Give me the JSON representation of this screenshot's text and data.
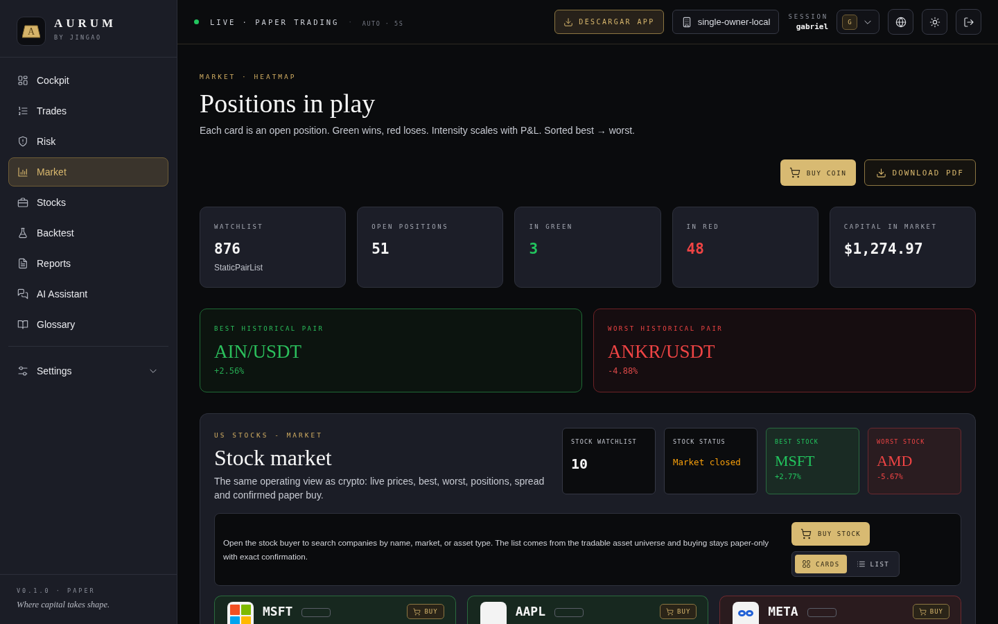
{
  "sidebar": {
    "brand": {
      "mark": "A",
      "name": "AURUM",
      "tagline": "BY JINGAO"
    },
    "nav_items": [
      {
        "label": "Cockpit",
        "selected": false
      },
      {
        "label": "Trades",
        "selected": false
      },
      {
        "label": "Risk",
        "selected": false
      },
      {
        "label": "Market",
        "selected": true
      },
      {
        "label": "Stocks",
        "selected": false
      },
      {
        "label": "Backtest",
        "selected": false
      },
      {
        "label": "Reports",
        "selected": false
      },
      {
        "label": "AI Assistant",
        "selected": false
      },
      {
        "label": "Glossary",
        "selected": false
      }
    ],
    "settings": {
      "label": "Settings",
      "expanded": false
    },
    "footer": {
      "version": "V0.1.0 · PAPER",
      "motto": "Where capital takes shape."
    }
  },
  "top_bar": {
    "live": true,
    "status": "LIVE · PAPER TRADING",
    "separator": "·",
    "refresh": "AUTO · 5S",
    "download_button": "DESCARGAR APP",
    "workspace": "single-owner-local",
    "session_label": "SESSION",
    "session_user": "gabriel",
    "avatar_initial": "G"
  },
  "header": {
    "eyebrow": "MARKET · HEATMAP",
    "title": "Positions in play",
    "subtitle": "Each card is an open position. Green wins, red loses. Intensity scales with P&L. Sorted best → worst.",
    "actions": [
      {
        "label": "BUY COIN",
        "kind": "primary"
      },
      {
        "label": "DOWNLOAD PDF",
        "kind": "outline"
      }
    ]
  },
  "stats": [
    {
      "label": "WATCHLIST",
      "value": "876",
      "note": "StaticPairList",
      "kind": "neutral"
    },
    {
      "label": "OPEN POSITIONS",
      "value": "51",
      "kind": "neutral"
    },
    {
      "label": "IN GREEN",
      "value": "3",
      "kind": "gain"
    },
    {
      "label": "IN RED",
      "value": "48",
      "kind": "loss"
    },
    {
      "label": "CAPITAL IN MARKET",
      "value": "$1,274.97",
      "kind": "neutral"
    }
  ],
  "highlights": [
    {
      "label": "BEST HISTORICAL PAIR",
      "pair": "AIN/USDT",
      "change": "+2.56%",
      "kind": "gain"
    },
    {
      "label": "WORST HISTORICAL PAIR",
      "pair": "ANKR/USDT",
      "change": "-4.88%",
      "kind": "loss"
    }
  ],
  "stock_market": {
    "eyebrow": "US STOCKS - MARKET",
    "title": "Stock market",
    "description": "The same operating view as crypto: live prices, best, worst, positions, spread and confirmed paper buy.",
    "metrics": [
      {
        "label": "STOCK WATCHLIST",
        "value": "10",
        "kind": "count"
      },
      {
        "label": "STOCK STATUS",
        "value": "Market closed",
        "kind": "status"
      },
      {
        "label": "BEST STOCK",
        "value": "MSFT",
        "change": "+2.77%",
        "kind": "gain"
      },
      {
        "label": "WORST STOCK",
        "value": "AMD",
        "change": "-5.67%",
        "kind": "loss"
      }
    ],
    "buyer": {
      "text": "Open the stock buyer to search companies by name, market, or asset type. The list comes from the tradable asset universe and buying stays paper-only with exact confirmation.",
      "button": "BUY STOCK",
      "views": [
        {
          "label": "CARDS",
          "selected": true
        },
        {
          "label": "LIST",
          "selected": false
        }
      ]
    },
    "cards": [
      {
        "ticker": "MSFT",
        "button": "BUY",
        "kind": "gain"
      },
      {
        "ticker": "AAPL",
        "button": "BUY",
        "kind": "gain"
      },
      {
        "ticker": "META",
        "button": "BUY",
        "kind": "loss"
      }
    ]
  }
}
